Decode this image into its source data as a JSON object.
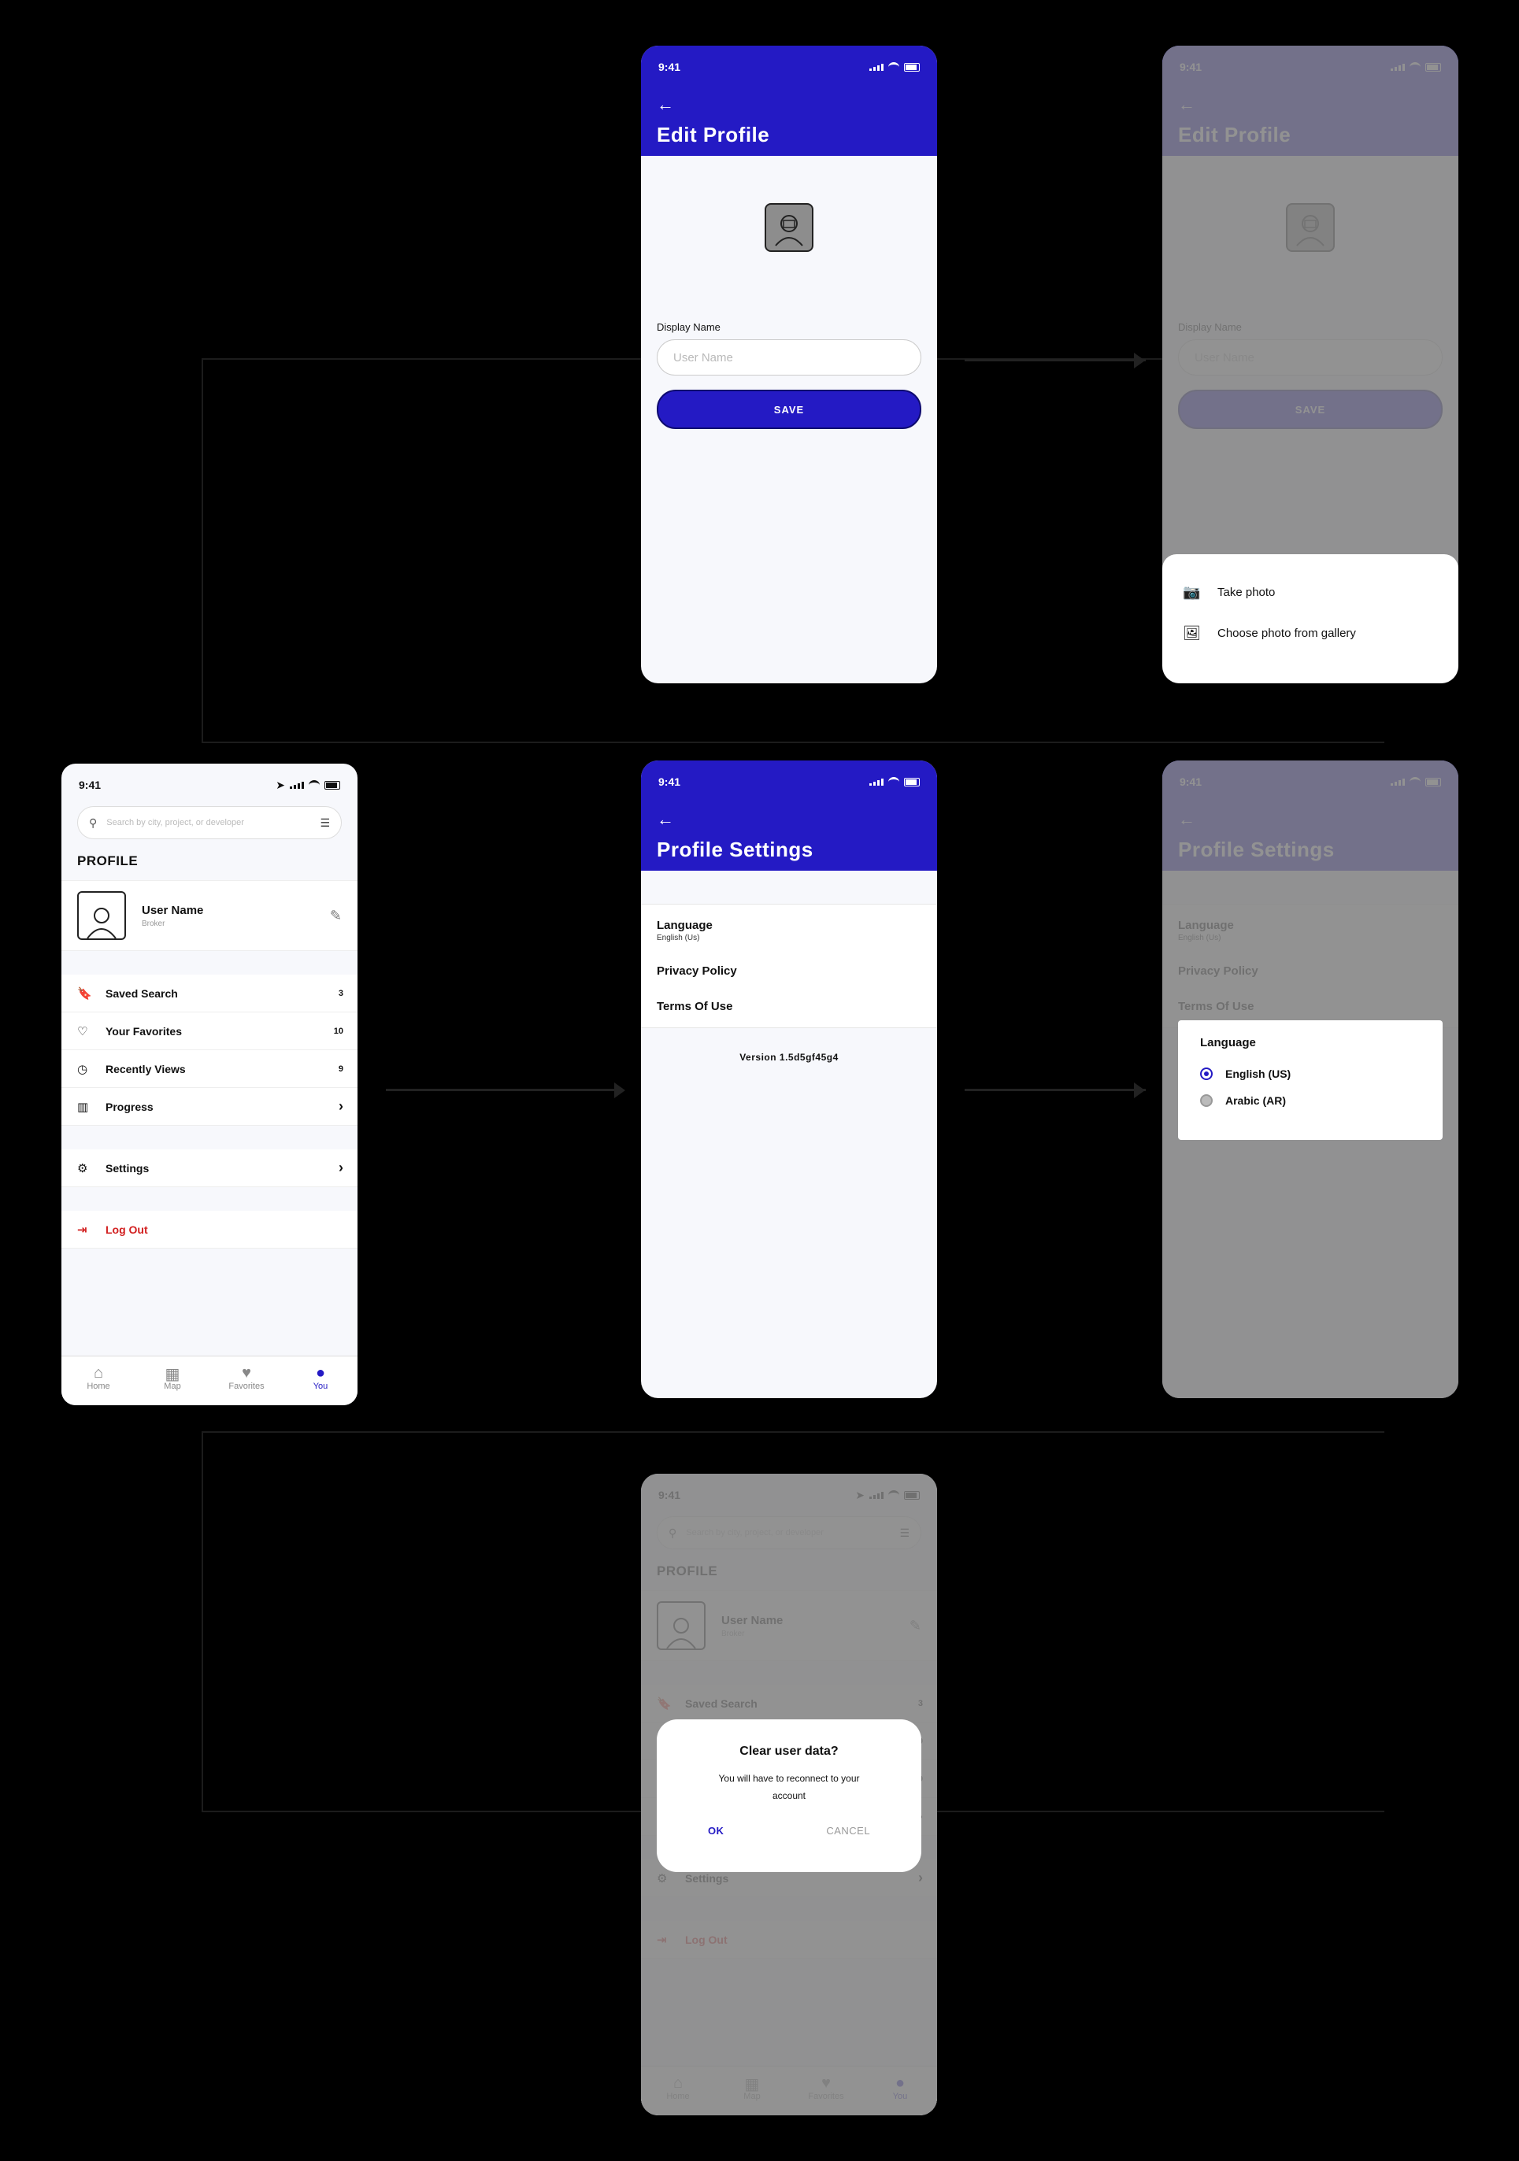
{
  "status_time": "9:41",
  "edit_profile": {
    "title": "Edit Profile",
    "display_name_label": "Display Name",
    "username_placeholder": "User Name",
    "save_label": "SAVE"
  },
  "photo_sheet": {
    "take_photo": "Take photo",
    "choose_gallery": "Choose photo from gallery"
  },
  "profile_settings": {
    "title": "Profile Settings",
    "language_label": "Language",
    "language_value": "English (Us)",
    "privacy": "Privacy Policy",
    "terms": "Terms Of Use",
    "version": "Version 1.5d5gf45g4"
  },
  "language_dialog": {
    "title": "Language",
    "options": [
      "English (US)",
      "Arabic (AR)"
    ],
    "selected": "English (US)"
  },
  "profile": {
    "search_placeholder": "Search by city, project, or developer",
    "page_title": "PROFILE",
    "user_name": "User Name",
    "user_role": "Broker",
    "menu": [
      {
        "label": "Saved Search",
        "count": "3"
      },
      {
        "label": "Your Favorites",
        "count": "10"
      },
      {
        "label": "Recently Views",
        "count": "9"
      },
      {
        "label": "Progress",
        "count": ""
      }
    ],
    "settings": "Settings",
    "logout": "Log Out",
    "tabs": [
      "Home",
      "Map",
      "Favorites",
      "You"
    ],
    "active_tab": "You"
  },
  "confirm_dialog": {
    "title": "Clear user data?",
    "message": "You will have to reconnect to your account",
    "ok": "OK",
    "cancel": "CANCEL"
  },
  "colors": {
    "brand": "#241ac4",
    "danger": "#d22020"
  }
}
